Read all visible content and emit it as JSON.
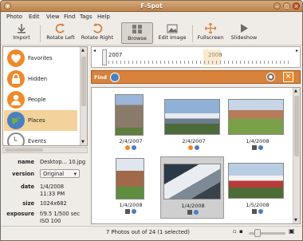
{
  "window": {
    "title": "F-Spot"
  },
  "menu": [
    "Photo",
    "Edit",
    "View",
    "Find",
    "Tags",
    "Help"
  ],
  "toolbar": {
    "import": "Import",
    "rotate_left": "Rotate Left",
    "rotate_right": "Rotate Right",
    "browse": "Browse",
    "edit_image": "Edit Image",
    "fullscreen": "Fullscreen",
    "slideshow": "Slideshow"
  },
  "sidebar": {
    "items": [
      {
        "label": "Favorites",
        "icon": "heart-icon",
        "color": "#f0892a"
      },
      {
        "label": "Hidden",
        "icon": "lock-icon",
        "color": "#f0892a"
      },
      {
        "label": "People",
        "icon": "person-icon",
        "color": "#f0892a"
      },
      {
        "label": "Places",
        "icon": "globe-icon",
        "color": "#4a7fc0"
      },
      {
        "label": "Events",
        "icon": "clock-icon",
        "color": "#888888"
      }
    ],
    "selected": "Places"
  },
  "info": {
    "name_label": "name",
    "name": "Desktop... 10.jpg",
    "version_label": "version",
    "version": "Original",
    "date_label": "date",
    "date": "1/4/2008",
    "time": "11:33 PM",
    "size_label": "size",
    "size": "1024x682",
    "exposure_label": "exposure",
    "exposure": "f/9.5 1/500 sec",
    "iso": "ISO 100"
  },
  "timeline": {
    "year_left": "2007",
    "year_right": "2008"
  },
  "findbar": {
    "label": "Find"
  },
  "photos": [
    {
      "date": "2/4/2007",
      "tags": [
        "heart",
        "globe"
      ]
    },
    {
      "date": "2/4/2007",
      "tags": [
        "heart",
        "globe"
      ]
    },
    {
      "date": "1/4/2008",
      "tags": [
        "screen",
        "globe"
      ]
    },
    {
      "date": "1/4/2008",
      "tags": [
        "screen",
        "globe"
      ]
    },
    {
      "date": "1/4/2008",
      "tags": [
        "screen",
        "globe"
      ]
    },
    {
      "date": "1/5/2008",
      "tags": [
        "screen",
        "globe"
      ]
    }
  ],
  "status": {
    "text": "7 Photos out of 24 (1 selected)"
  },
  "colors": {
    "accent": "#d8823c",
    "titlebar": "#c08a56",
    "selection": "#f3d39b"
  }
}
